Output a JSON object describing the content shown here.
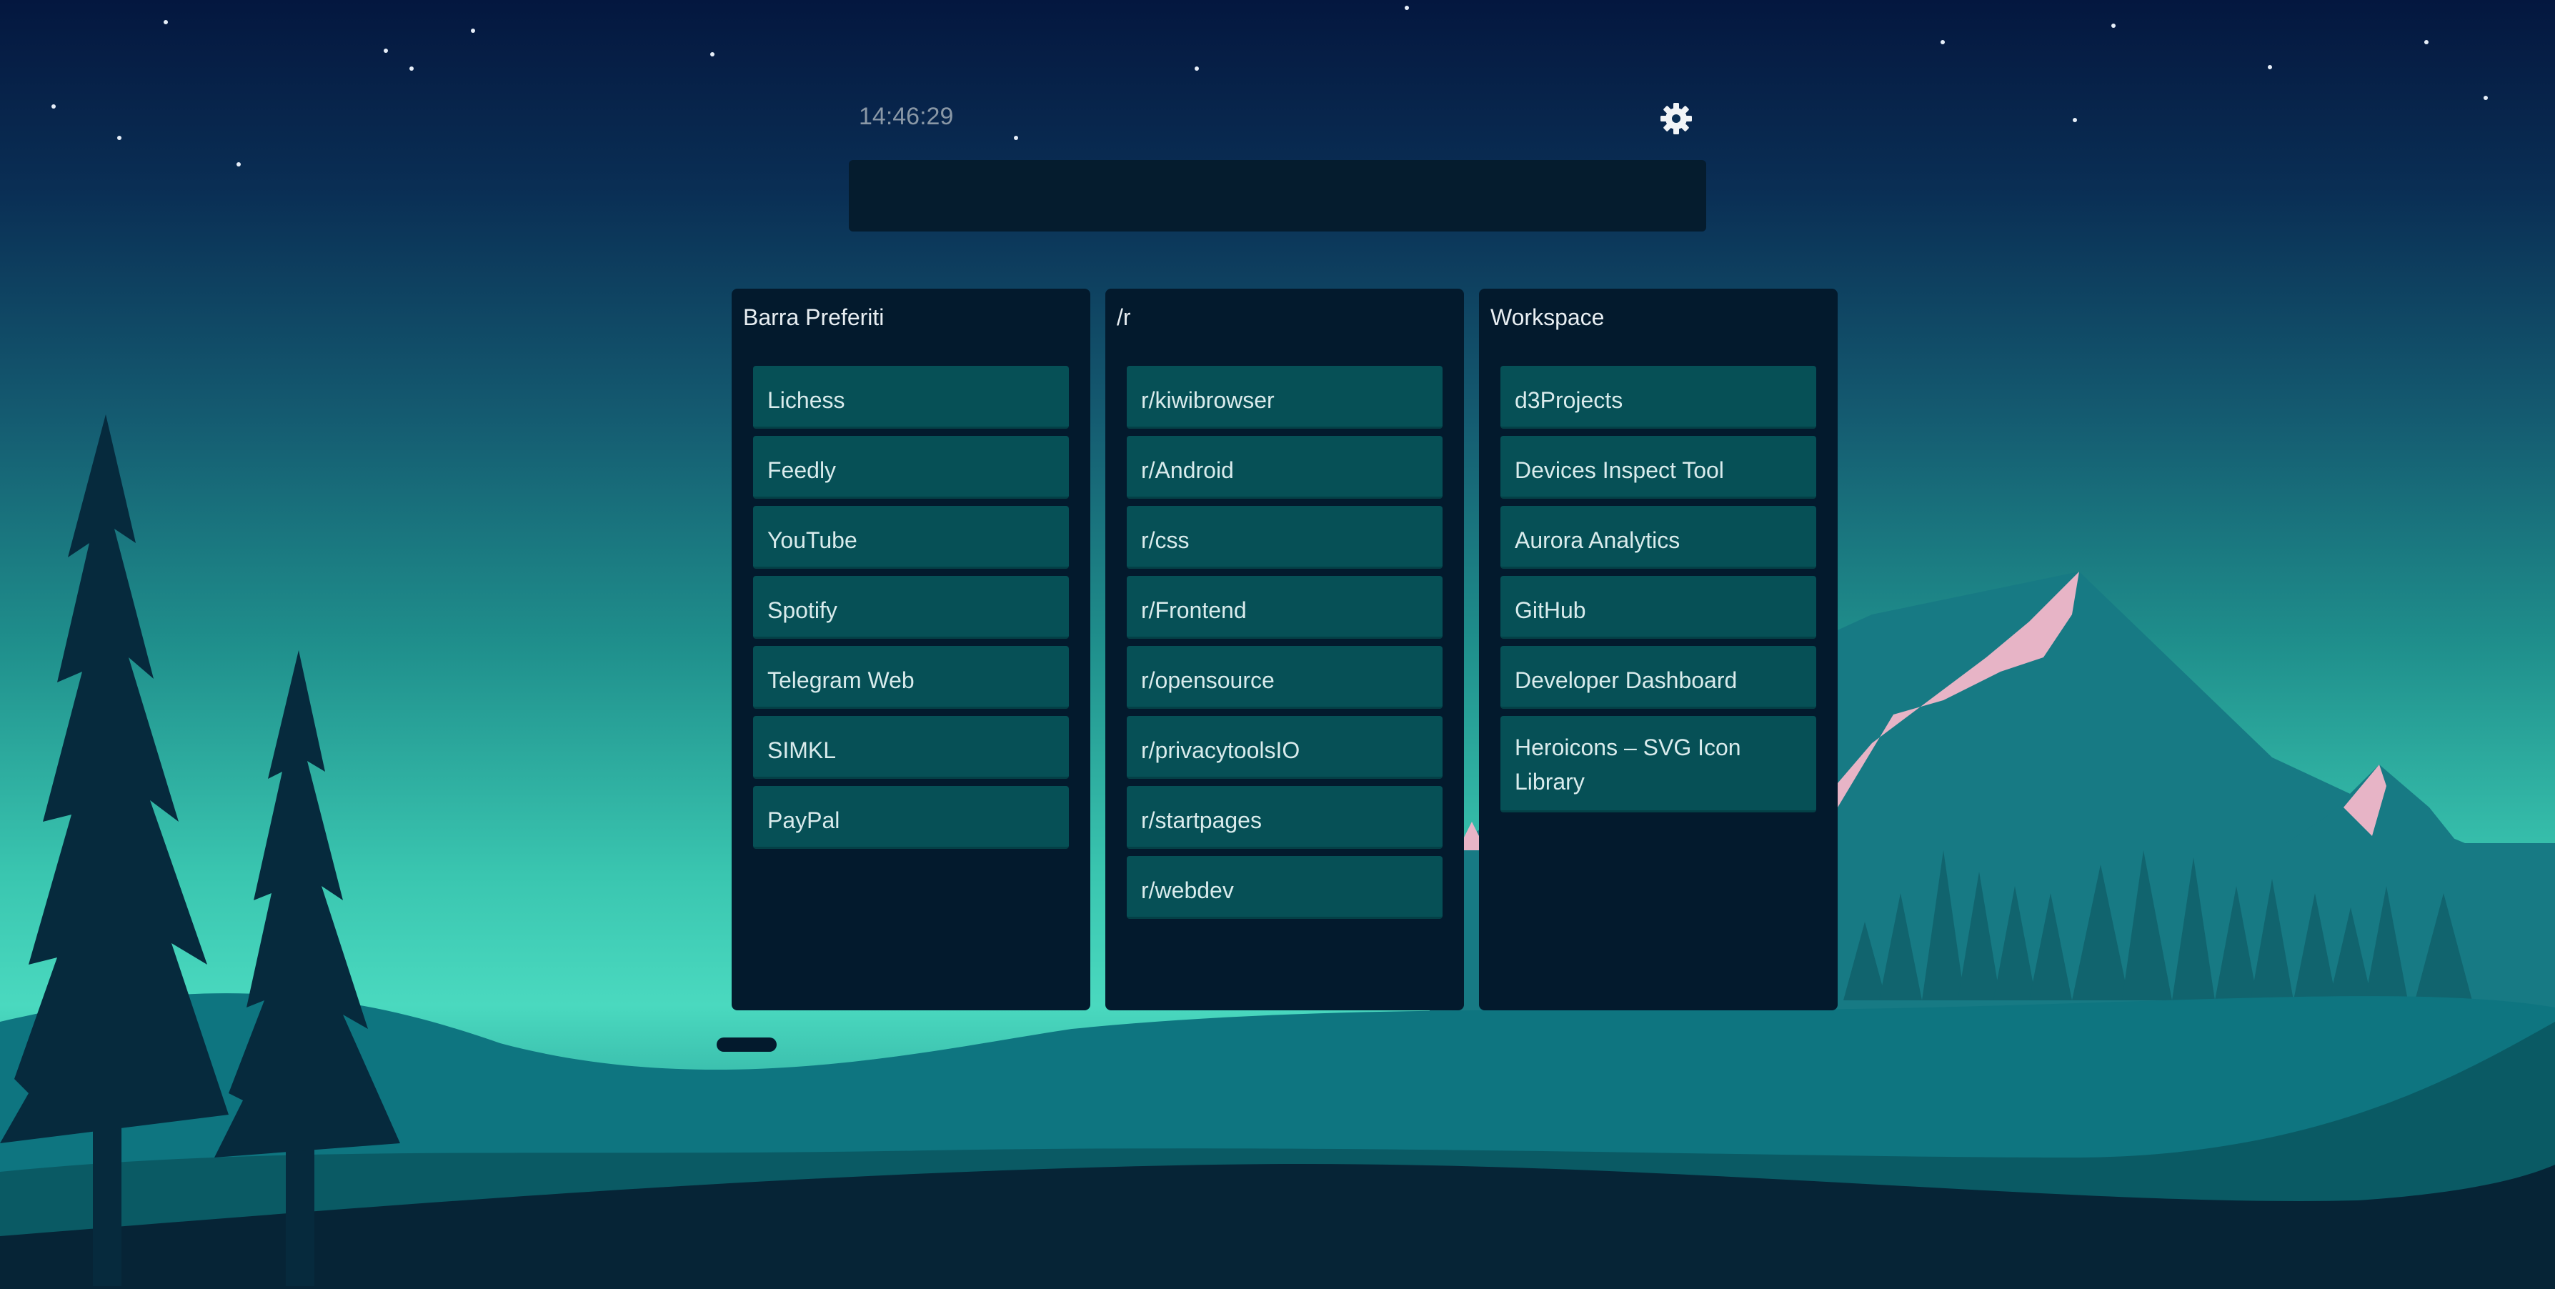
{
  "clock": "14:46:29",
  "search": {
    "value": "",
    "placeholder": ""
  },
  "icons": {
    "settings": "gear-icon"
  },
  "colors": {
    "panel": "#031a2d",
    "link_bg": "#065056",
    "link_text": "#d9ebec",
    "sky_top": "#04173f",
    "mountain_snow": "#e7b4c6"
  },
  "columns": [
    {
      "title": "Barra Preferiti",
      "links": [
        "Lichess",
        "Feedly",
        "YouTube",
        "Spotify",
        "Telegram Web",
        "SIMKL",
        "PayPal"
      ]
    },
    {
      "title": "/r",
      "links": [
        "r/kiwibrowser",
        "r/Android",
        "r/css",
        "r/Frontend",
        "r/opensource",
        "r/privacytoolsIO",
        "r/startpages",
        "r/webdev"
      ]
    },
    {
      "title": "Workspace",
      "links": [
        "d3Projects",
        "Devices Inspect Tool",
        "Aurora Analytics",
        "GitHub",
        "Developer Dashboard",
        "Heroicons – SVG Icon Library"
      ]
    }
  ]
}
